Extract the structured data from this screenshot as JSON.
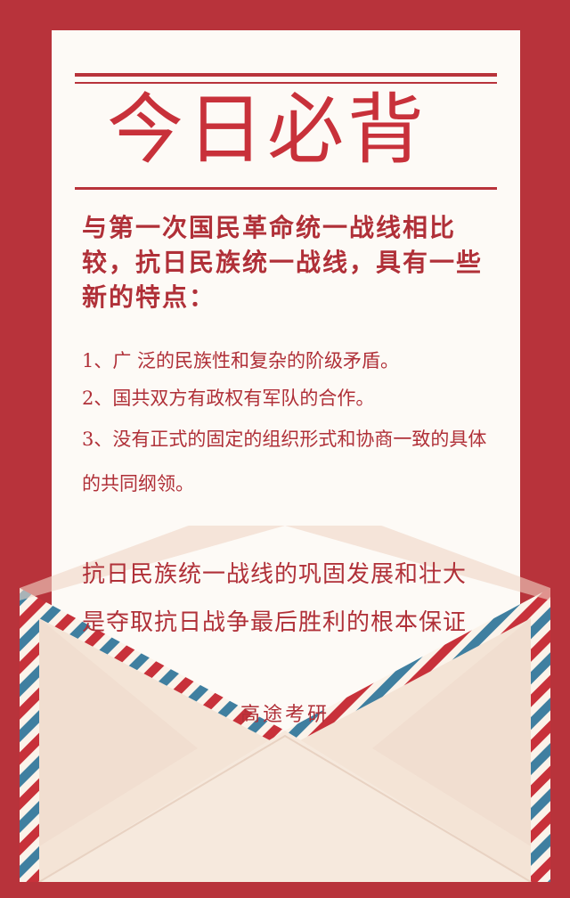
{
  "poster": {
    "title": "今日必背",
    "intro": "与第一次国民革命统一战线相比较，抗日民族统一战线，具有一些新的特点：",
    "items": [
      "1、广 泛的民族性和复杂的阶级矛盾。",
      "2、国共双方有政权有军队的合作。",
      "3、没有正式的固定的组织形式和协商一致的具体的共同纲领。"
    ],
    "conclusion": [
      "抗日民族统一战线的巩固发展和壮大",
      "是夺取抗日战争最后胜利的根本保证"
    ],
    "footer": "高途考研"
  },
  "colors": {
    "background": "#b8333b",
    "paper": "#fdfaf6",
    "envelope": "#f4e4d6",
    "text": "#b03038",
    "stripe_blue": "#3f7fa0",
    "stripe_red": "#c8313a"
  }
}
